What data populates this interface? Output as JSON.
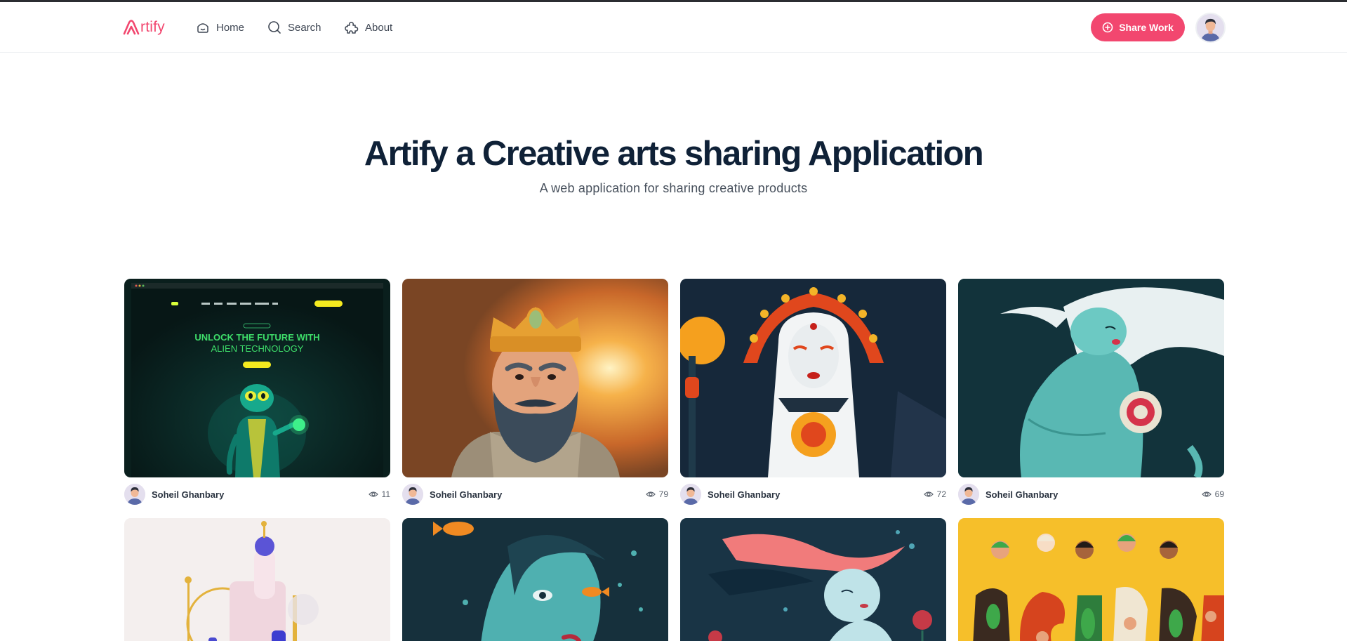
{
  "brand": {
    "logo_text": "rtify",
    "accent": "#f2476f"
  },
  "nav": {
    "items": [
      {
        "label": "Home",
        "icon": "home-icon"
      },
      {
        "label": "Search",
        "icon": "search-icon"
      },
      {
        "label": "About",
        "icon": "puzzle-icon"
      }
    ],
    "share_label": "Share Work"
  },
  "hero": {
    "title": "Artify a Creative arts sharing Application",
    "subtitle": "A web application for sharing creative products"
  },
  "works": [
    {
      "author": "Soheil Ghanbary",
      "views": "11"
    },
    {
      "author": "Soheil Ghanbary",
      "views": "79"
    },
    {
      "author": "Soheil Ghanbary",
      "views": "72"
    },
    {
      "author": "Soheil Ghanbary",
      "views": "69"
    },
    {
      "author": "",
      "views": ""
    },
    {
      "author": "",
      "views": ""
    },
    {
      "author": "",
      "views": ""
    },
    {
      "author": "",
      "views": ""
    }
  ],
  "artwork_text": {
    "headline_1": "UNLOCK THE FUTURE WITH",
    "headline_2": "ALIEN TECHNOLOGY"
  }
}
